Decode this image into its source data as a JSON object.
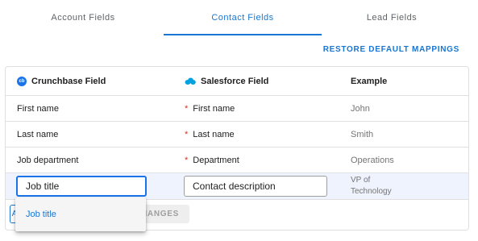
{
  "tabs": [
    {
      "label": "Account Fields",
      "active": false
    },
    {
      "label": "Contact Fields",
      "active": true
    },
    {
      "label": "Lead Fields",
      "active": false
    }
  ],
  "restore_label": "RESTORE DEFAULT MAPPINGS",
  "table": {
    "headers": {
      "crunchbase": "Crunchbase Field",
      "crunchbase_logo": "cb",
      "salesforce": "Salesforce Field",
      "example": "Example"
    },
    "rows": [
      {
        "crunchbase": "First name",
        "salesforce": "First name",
        "required": "*",
        "example": "John"
      },
      {
        "crunchbase": "Last name",
        "salesforce": "Last name",
        "required": "*",
        "example": "Smith"
      },
      {
        "crunchbase": "Job department",
        "salesforce": "Department",
        "required": "*",
        "example": "Operations"
      }
    ],
    "editing_row": {
      "crunchbase_value": "Job title",
      "salesforce_value": "Contact description",
      "example_line1": "VP of",
      "example_line2": "Technology"
    }
  },
  "buttons": {
    "add_partial": "A",
    "save_partial": "HANGES"
  },
  "dropdown": {
    "options": [
      "Job title"
    ]
  },
  "colors": {
    "accent": "#1976d2",
    "required": "#d93025",
    "salesforce_logo": "#00a1e0",
    "crunchbase_logo": "#1a73e8",
    "editing_row_bg": "#eef3fd"
  }
}
